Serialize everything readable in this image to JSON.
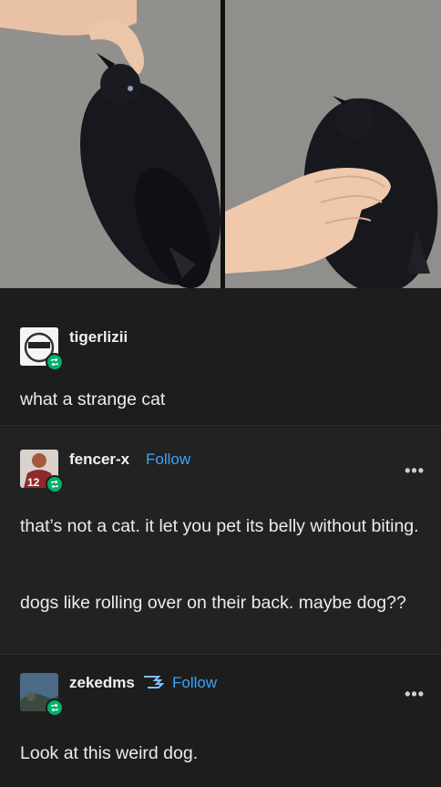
{
  "posts": [
    {
      "username": "tigerlizii",
      "body": [
        "what a strange cat"
      ]
    },
    {
      "username": "fencer-x",
      "follow_label": "Follow",
      "more_label": "•••",
      "body": [
        "that’s not a cat. it let you pet its belly without biting.",
        "dogs like rolling over on their back. maybe dog??"
      ]
    },
    {
      "username": "zekedms",
      "follow_label": "Follow",
      "more_label": "•••",
      "body": [
        "Look at this weird dog."
      ]
    }
  ],
  "colors": {
    "background": "#1d1d1d",
    "follow": "#3aa3ff",
    "reblog_badge": "#00b06b"
  }
}
